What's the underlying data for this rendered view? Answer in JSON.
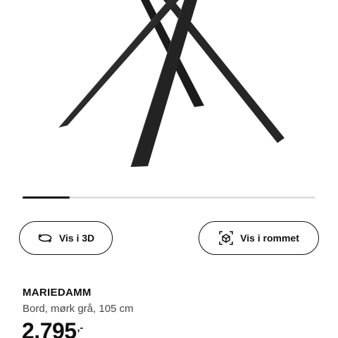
{
  "gallery": {
    "progress_fraction": 0.16
  },
  "buttons": {
    "view_3d": {
      "label": "Vis i 3D",
      "icon": "rotate-3d-icon"
    },
    "view_in_room": {
      "label": "Vis i rommet",
      "icon": "ar-view-icon"
    }
  },
  "product": {
    "name": "MARIEDAMM",
    "description": "Bord, mørk grå, 105 cm",
    "price": "2.795",
    "price_suffix": ",-"
  },
  "colors": {
    "text": "#111111",
    "secondary_text": "#484848",
    "track": "#dfdfdf",
    "table_leg": "#2a2a2a"
  }
}
